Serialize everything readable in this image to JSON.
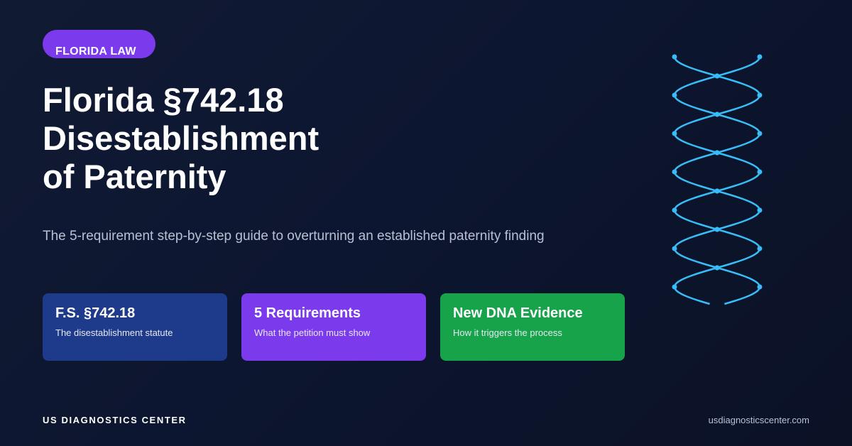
{
  "tag": {
    "label": "FLORIDA LAW"
  },
  "title": {
    "lines": [
      "Florida §742.18",
      "Disestablishment",
      "of Paternity"
    ]
  },
  "subtitle": "The 5-requirement step-by-step guide to overturning an established paternity finding",
  "cards": [
    {
      "title": "F.S. §742.18",
      "description": "The disestablishment statute",
      "color": "#1e3a8a"
    },
    {
      "title": "5 Requirements",
      "description": "What the petition must show",
      "color": "#7c3aed"
    },
    {
      "title": "New DNA Evidence",
      "description": "How it triggers the process",
      "color": "#16a34a"
    }
  ],
  "footer": {
    "brand": "US DIAGNOSTICS CENTER",
    "website": "usdiagnosticscenter.com"
  },
  "decoration": {
    "icon": "dna-helix-icon",
    "color": "#38bdf8"
  },
  "colors": {
    "background": "#0d1630",
    "accent_purple": "#7c3aed",
    "accent_blue": "#1e3a8a",
    "accent_green": "#16a34a"
  }
}
